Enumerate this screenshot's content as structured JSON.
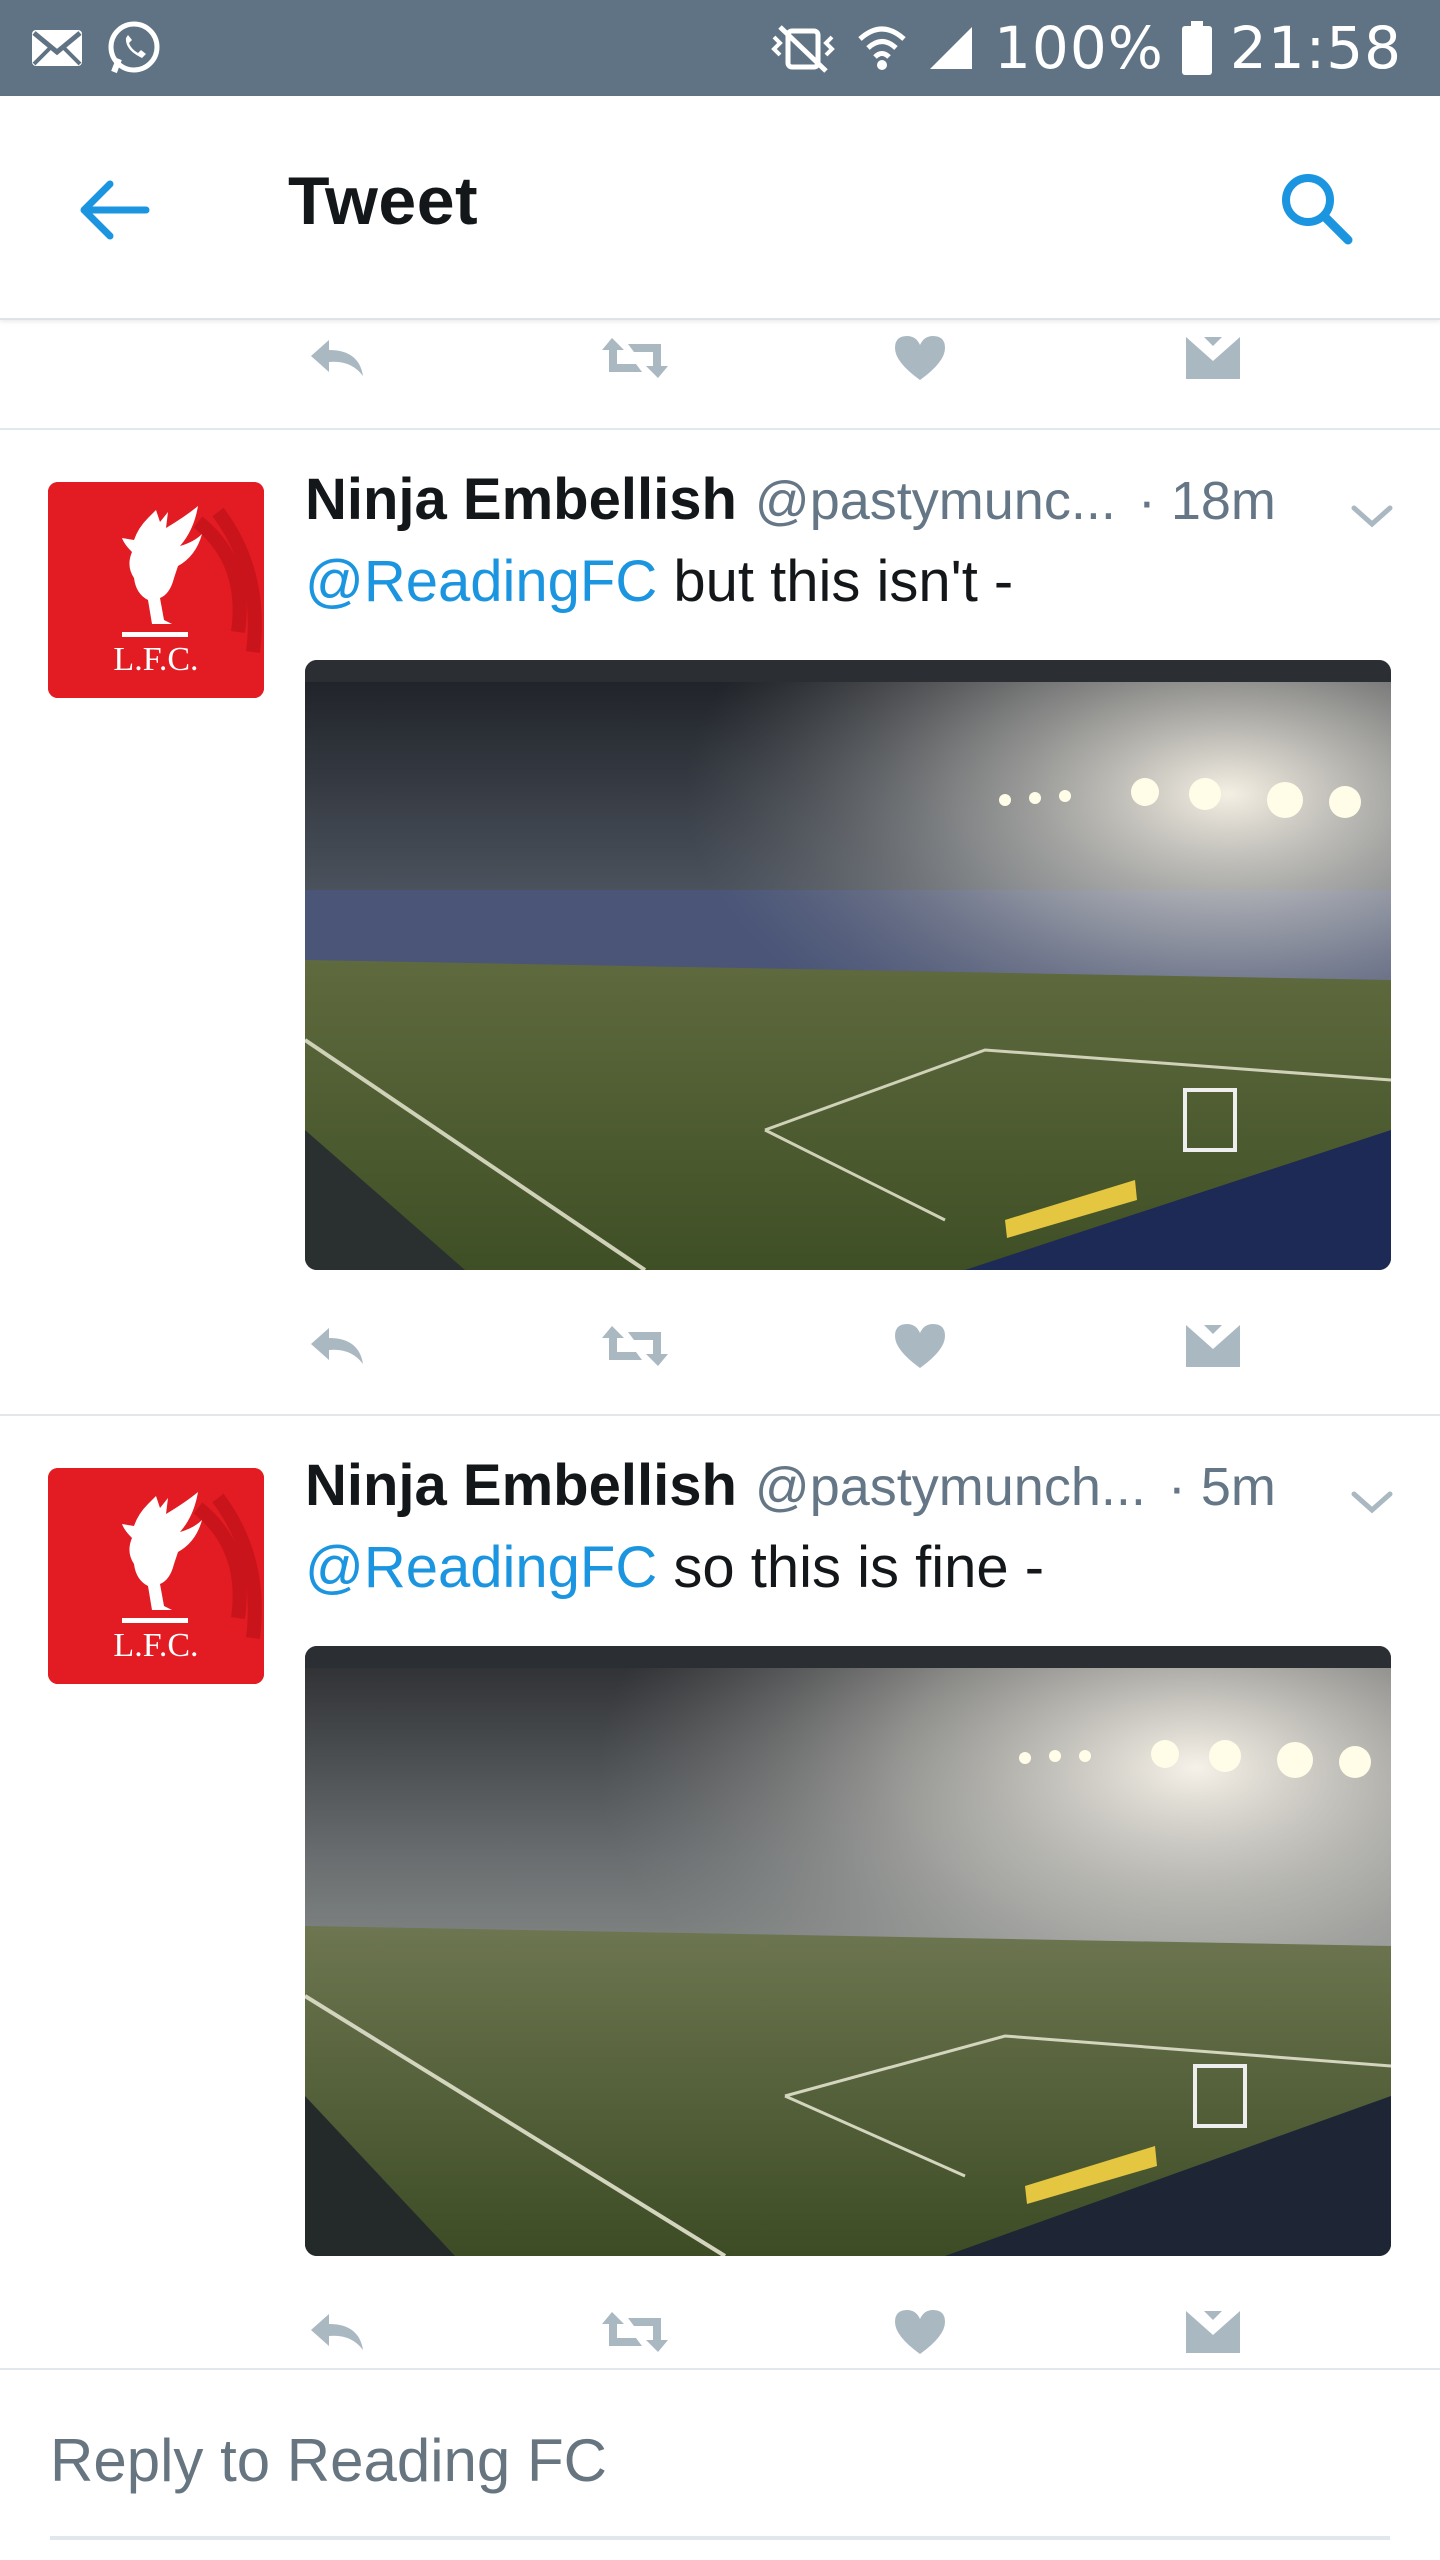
{
  "status_bar": {
    "battery": "100%",
    "time": "21:58",
    "icons": [
      "mail-icon",
      "whatsapp-icon",
      "mute-icon",
      "wifi-icon",
      "signal-icon",
      "battery-icon"
    ]
  },
  "header": {
    "title": "Tweet",
    "back_icon": "arrow-left-icon",
    "search_icon": "search-icon"
  },
  "colors": {
    "status_bar": "#5f7384",
    "accent": "#1b95e0",
    "muted": "#657786",
    "action_icon": "#aab8c2",
    "avatar_red": "#e31b23"
  },
  "tweets": [
    {
      "name": "Ninja Embellish",
      "handle": "@pastymunc...",
      "time": "· 18m",
      "mention": "@ReadingFC",
      "text": " but this isn't -",
      "avatar_text": "L.F.C."
    },
    {
      "name": "Ninja Embellish",
      "handle": "@pastymunch...",
      "time": "· 5m",
      "mention": "@ReadingFC",
      "text": " so this is fine -",
      "avatar_text": "L.F.C."
    }
  ],
  "reply_bar": {
    "placeholder": "Reply to Reading FC"
  }
}
